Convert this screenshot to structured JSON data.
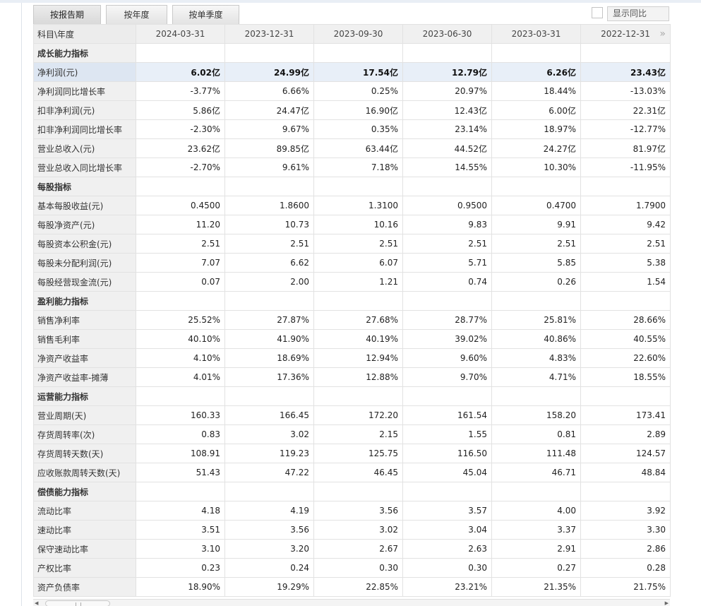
{
  "tabs": [
    {
      "label": "按报告期"
    },
    {
      "label": "按年度"
    },
    {
      "label": "按单季度"
    }
  ],
  "yoy_toggle": {
    "label": "显示同比",
    "checked": false
  },
  "table": {
    "header_label": "科目\\年度",
    "columns": [
      "2024-03-31",
      "2023-12-31",
      "2023-09-30",
      "2023-06-30",
      "2023-03-31",
      "2022-12-31"
    ],
    "more_icon": "double-chevron-right-icon",
    "rows": [
      {
        "label": "成长能力指标",
        "section": true
      },
      {
        "label": "净利润(元)",
        "highlight": true,
        "values": [
          "6.02亿",
          "24.99亿",
          "17.54亿",
          "12.79亿",
          "6.26亿",
          "23.43亿"
        ]
      },
      {
        "label": "净利润同比增长率",
        "values": [
          "-3.77%",
          "6.66%",
          "0.25%",
          "20.97%",
          "18.44%",
          "-13.03%"
        ]
      },
      {
        "label": "扣非净利润(元)",
        "values": [
          "5.86亿",
          "24.47亿",
          "16.90亿",
          "12.43亿",
          "6.00亿",
          "22.31亿"
        ]
      },
      {
        "label": "扣非净利润同比增长率",
        "values": [
          "-2.30%",
          "9.67%",
          "0.35%",
          "23.14%",
          "18.97%",
          "-12.77%"
        ]
      },
      {
        "label": "营业总收入(元)",
        "values": [
          "23.62亿",
          "89.85亿",
          "63.44亿",
          "44.52亿",
          "24.27亿",
          "81.97亿"
        ]
      },
      {
        "label": "营业总收入同比增长率",
        "values": [
          "-2.70%",
          "9.61%",
          "7.18%",
          "14.55%",
          "10.30%",
          "-11.95%"
        ]
      },
      {
        "label": "每股指标",
        "section": true
      },
      {
        "label": "基本每股收益(元)",
        "values": [
          "0.4500",
          "1.8600",
          "1.3100",
          "0.9500",
          "0.4700",
          "1.7900"
        ]
      },
      {
        "label": "每股净资产(元)",
        "values": [
          "11.20",
          "10.73",
          "10.16",
          "9.83",
          "9.91",
          "9.42"
        ]
      },
      {
        "label": "每股资本公积金(元)",
        "values": [
          "2.51",
          "2.51",
          "2.51",
          "2.51",
          "2.51",
          "2.51"
        ]
      },
      {
        "label": "每股未分配利润(元)",
        "values": [
          "7.07",
          "6.62",
          "6.07",
          "5.71",
          "5.85",
          "5.38"
        ]
      },
      {
        "label": "每股经营现金流(元)",
        "values": [
          "0.07",
          "2.00",
          "1.21",
          "0.74",
          "0.26",
          "1.54"
        ]
      },
      {
        "label": "盈利能力指标",
        "section": true
      },
      {
        "label": "销售净利率",
        "values": [
          "25.52%",
          "27.87%",
          "27.68%",
          "28.77%",
          "25.81%",
          "28.66%"
        ]
      },
      {
        "label": "销售毛利率",
        "values": [
          "40.10%",
          "41.90%",
          "40.19%",
          "39.02%",
          "40.86%",
          "40.55%"
        ]
      },
      {
        "label": "净资产收益率",
        "values": [
          "4.10%",
          "18.69%",
          "12.94%",
          "9.60%",
          "4.83%",
          "22.60%"
        ]
      },
      {
        "label": "净资产收益率-摊薄",
        "values": [
          "4.01%",
          "17.36%",
          "12.88%",
          "9.70%",
          "4.71%",
          "18.55%"
        ]
      },
      {
        "label": "运营能力指标",
        "section": true
      },
      {
        "label": "营业周期(天)",
        "values": [
          "160.33",
          "166.45",
          "172.20",
          "161.54",
          "158.20",
          "173.41"
        ]
      },
      {
        "label": "存货周转率(次)",
        "values": [
          "0.83",
          "3.02",
          "2.15",
          "1.55",
          "0.81",
          "2.89"
        ]
      },
      {
        "label": "存货周转天数(天)",
        "values": [
          "108.91",
          "119.23",
          "125.75",
          "116.50",
          "111.48",
          "124.57"
        ]
      },
      {
        "label": "应收账款周转天数(天)",
        "values": [
          "51.43",
          "47.22",
          "46.45",
          "45.04",
          "46.71",
          "48.84"
        ]
      },
      {
        "label": "偿债能力指标",
        "section": true
      },
      {
        "label": "流动比率",
        "values": [
          "4.18",
          "4.19",
          "3.56",
          "3.57",
          "4.00",
          "3.92"
        ]
      },
      {
        "label": "速动比率",
        "values": [
          "3.51",
          "3.56",
          "3.02",
          "3.04",
          "3.37",
          "3.30"
        ]
      },
      {
        "label": "保守速动比率",
        "values": [
          "3.10",
          "3.20",
          "2.67",
          "2.63",
          "2.91",
          "2.86"
        ]
      },
      {
        "label": "产权比率",
        "values": [
          "0.23",
          "0.24",
          "0.30",
          "0.30",
          "0.27",
          "0.28"
        ]
      },
      {
        "label": "资产负债率",
        "values": [
          "18.90%",
          "19.29%",
          "22.85%",
          "23.21%",
          "21.35%",
          "21.75%"
        ]
      }
    ]
  }
}
